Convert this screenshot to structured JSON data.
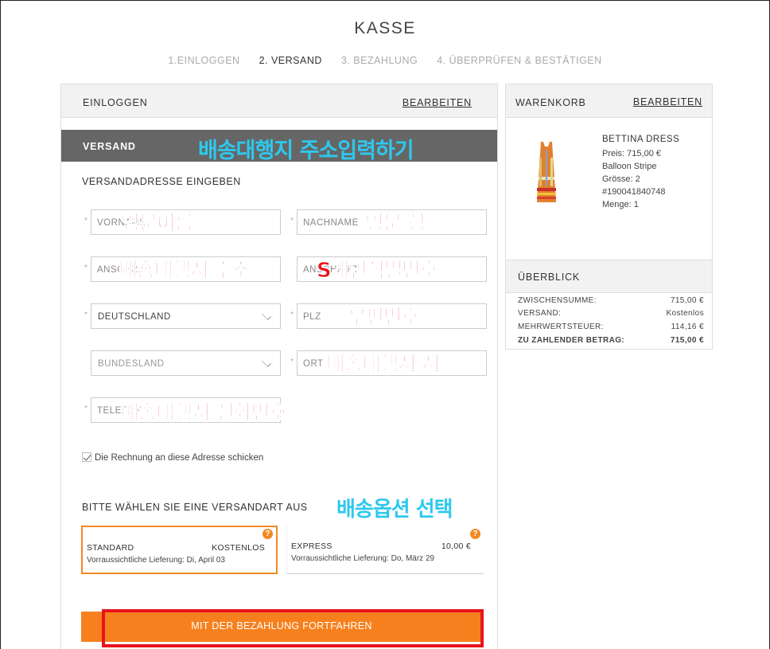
{
  "page": {
    "title": "KASSE"
  },
  "steps": [
    {
      "label": "1.EINLOGGEN"
    },
    {
      "label": "2. VERSAND"
    },
    {
      "label": "3. BEZAHLUNG"
    },
    {
      "label": "4. ÜBERPRÜFEN & BESTÄTIGEN"
    }
  ],
  "login": {
    "label": "EINLOGGEN",
    "edit": "BEARBEITEN"
  },
  "shipping": {
    "label": "VERSAND",
    "note": "배송대행지 주소입력하기",
    "address_title": "VERSANDADRESSE EINGEBEN",
    "fields": {
      "firstname": {
        "placeholder": "VORNAME",
        "note": "영문이름"
      },
      "lastname": {
        "placeholder": "NACHNAME",
        "note": "영문 성"
      },
      "address1": {
        "placeholder": "ANSCHRIFT",
        "note": "배송대행지 주소"
      },
      "address2": {
        "placeholder": "ANSCHRIFT",
        "note": "S개인식별번호"
      },
      "country": {
        "value": "DEUTSCHLAND"
      },
      "zip": {
        "placeholder": "PLZ",
        "note": "우편번호"
      },
      "state": {
        "value": "BUNDESLAND"
      },
      "city": {
        "placeholder": "ORT",
        "note": "배송대행지 시"
      },
      "phone": {
        "placeholder": "TELEFON",
        "note": "배송대행지 전화번호"
      }
    },
    "billing_checkbox": "Die Rechnung an diese Adresse schicken",
    "method_title": "BITTE WÄHLEN SIE EINE VERSANDART AUS",
    "method_note": "배송옵션 선택",
    "options": [
      {
        "name": "STANDARD",
        "price": "KOSTENLOS",
        "eta": "Vorraussichtliche Lieferung: Di, April 03"
      },
      {
        "name": "EXPRESS",
        "price": "10,00 €",
        "eta": "Vorraussichtliche Lieferung: Do, März 29"
      }
    ],
    "cta": "MIT DER BEZAHLUNG FORTFAHREN"
  },
  "cart": {
    "label": "WARENKORB",
    "edit": "BEARBEITEN",
    "product": {
      "name": "BETTINA DRESS",
      "price": "Preis:  715,00 €",
      "color": "Balloon Stripe",
      "size": "Grösse:  2",
      "sku": "#190041840748",
      "qty": "Menge: 1"
    },
    "overview_label": "ÜBERBLICK",
    "summary": [
      {
        "label": "ZWISCHENSUMME:",
        "value": "715,00 €"
      },
      {
        "label": "VERSAND:",
        "value": "Kostenlos"
      },
      {
        "label": "MEHRWERTSTEUER:",
        "value": "114,16 €"
      },
      {
        "label": "ZU ZAHLENDER BETRAG:",
        "value": "715,00 €"
      }
    ]
  },
  "colors": {
    "accent": "#f7801e",
    "annotation_red": "#e8131b",
    "annotation_blue": "#2ec8ee"
  }
}
